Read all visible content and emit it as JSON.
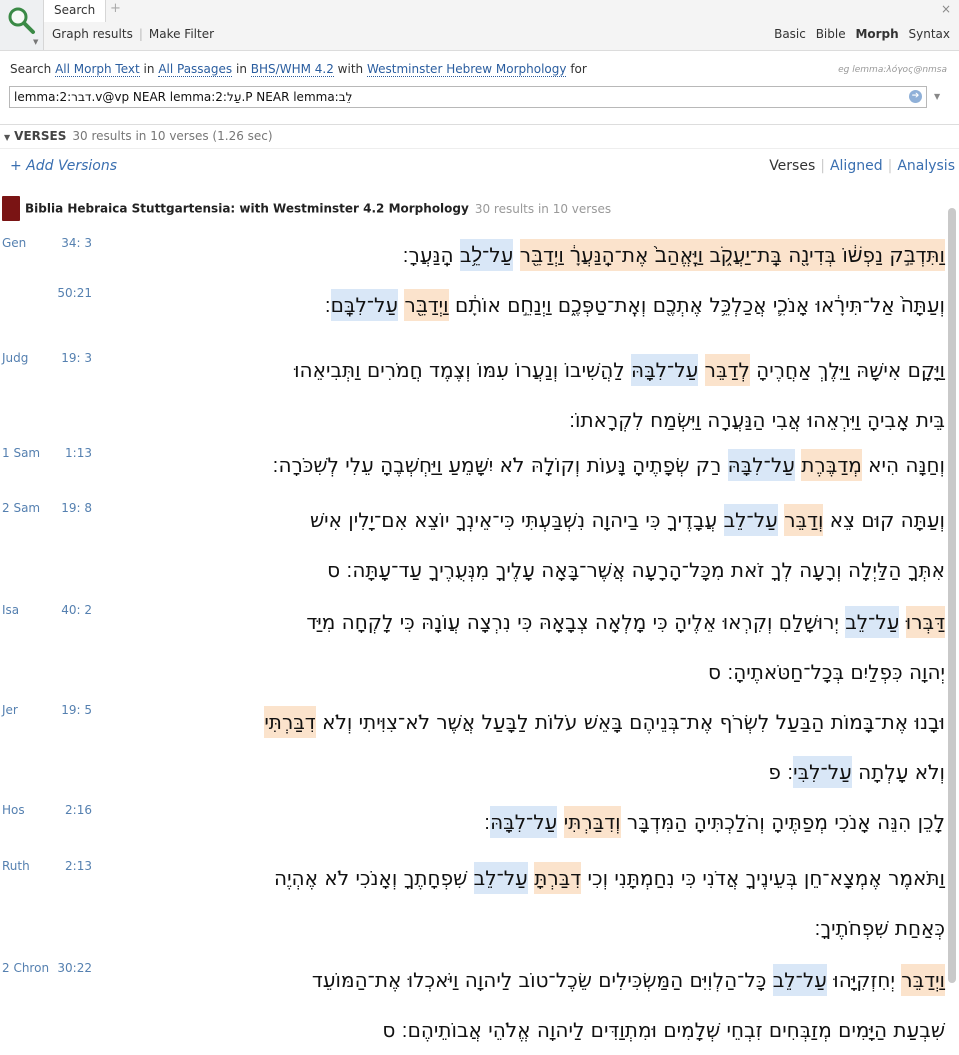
{
  "tab": {
    "label": "Search",
    "add": "+",
    "close": "×"
  },
  "toolbar": {
    "graph": "Graph results",
    "filter": "Make Filter"
  },
  "modes": [
    "Basic",
    "Bible",
    "Morph",
    "Syntax"
  ],
  "search": {
    "prefix": "Search",
    "scope": "All Morph Text",
    "in1": "in",
    "passages": "All Passages",
    "in2": "in",
    "version": "BHS/WHM 4.2",
    "with": "with",
    "morph": "Westminster Hebrew Morphology",
    "for": "for",
    "example": "eg lemma:λόγος@nmsa",
    "query": "lemma:2:דבר.v@vp NEAR lemma:2:עַל.P NEAR lemma:לֵב"
  },
  "verses_bar": {
    "label": "VERSES",
    "stats": "30 results in 10 verses (1.26 sec)"
  },
  "add_versions": "+ Add Versions",
  "views": [
    "Verses",
    "Aligned",
    "Analysis"
  ],
  "resource": {
    "title": "Biblia Hebraica Stuttgartensia: with Westminster 4.2 Morphology",
    "count": "30 results in 10 verses"
  },
  "results": [
    {
      "book": "Gen",
      "ref": "34:  3",
      "lines": [
        [
          [
            "וַתִּדְבַּ֣ק נַפְשׁ֔וֹ בְּדִינָ֖ה בַּֽת־יַעֲקֹ֑ב וַיֶּֽאֱהַב֙ אֶת־הַֽנַּעֲרָ֔ וַיְדַבֵּ֖ר",
            "hl-o"
          ],
          [
            " ",
            ""
          ],
          [
            "עַל־לֵ֥ב",
            "hl-b"
          ],
          [
            " הַֽנַּעֲרָ׃",
            ""
          ]
        ]
      ]
    },
    {
      "book": "",
      "ref": "50:21",
      "lines": [
        [
          [
            "וְעַתָּה֙ אַל־תִּירָ֔אוּ אָנֹכִ֛י אֲכַלְכֵּ֥ל אֶתְכֶ֖ם וְאֶֽת־טַפְּכֶ֑ם וַיְנַחֵ֣ם אוֹתָ֔ם",
            ""
          ],
          [
            " ",
            ""
          ],
          [
            "וַיְדַבֵּ֖ר",
            "hl-o"
          ],
          [
            " ",
            ""
          ],
          [
            "עַל־לִבָּֽם",
            "hl-b"
          ],
          [
            "׃",
            ""
          ]
        ]
      ]
    },
    {
      "book": "Judg",
      "ref": "19:  3",
      "lines": [
        [
          [
            "וַיָּקָם אִישָׁהּ וַיֵּלֶךְ אַחֲרֶיהָ ",
            ""
          ],
          [
            "לְדַבֵּר",
            "hl-o"
          ],
          [
            " ",
            ""
          ],
          [
            "עַל־לִבָּהּ",
            "hl-b"
          ],
          [
            " לַהֲשִׁיבוֹ וְנַעֲרוֹ עִמּוֹ וְצֶמֶד חֲמֹרִים וַתְּבִיאֵהוּ",
            ""
          ]
        ],
        [
          [
            "בֵּית אָבִיהָ וַיִּרְאֵהוּ אֲבִי הַנַּעֲרָה וַיִּשְׂמַח לִקְרָאתוֹ׃",
            ""
          ]
        ]
      ]
    },
    {
      "book": "1 Sam",
      "ref": "1:13",
      "lines": [
        [
          [
            "וְחַנָּה הִיא ",
            ""
          ],
          [
            "מְדַבֶּרֶת",
            "hl-o"
          ],
          [
            " ",
            ""
          ],
          [
            "עַל־לִבָּהּ",
            "hl-b"
          ],
          [
            " רַק שְׂפָתֶיהָ נָּעוֹת וְקוֹלָהּ לֹא יִשָּׁמֵעַ וַיַּחְשְׁבֶהָ עֵלִי לְשִׁכֹּרָה׃",
            ""
          ]
        ]
      ]
    },
    {
      "book": "2 Sam",
      "ref": "19:  8",
      "lines": [
        [
          [
            "וְעַתָּה קוּם צֵא ",
            ""
          ],
          [
            "וְדַבֵּר",
            "hl-o"
          ],
          [
            " ",
            ""
          ],
          [
            "עַל־לֵב",
            "hl-b"
          ],
          [
            " עֲבָדֶיךָ כִּי בַיהוָה נִשְׁבַּעְתִּי כִּי־אֵינְךָ יוֹצֵא אִם־יָלִין אִישׁ",
            ""
          ]
        ],
        [
          [
            "אִתְּךָ הַלַּיְלָה וְרָעָה לְךָ זֹאת מִכָּל־הָרָעָה אֲשֶׁר־בָּאָה עָלֶיךָ מִנְּעֻרֶיךָ עַד־עָתָּה׃ ס",
            ""
          ]
        ]
      ]
    },
    {
      "book": "Isa",
      "ref": "40:  2",
      "lines": [
        [
          [
            "דַּבְּרוּ",
            "hl-o"
          ],
          [
            " ",
            ""
          ],
          [
            "עַל־לֵב",
            "hl-b"
          ],
          [
            " יְרוּשָׁלַםִ וְקִרְאוּ אֵלֶיהָ כִּי מָלְאָה צְבָאָהּ כִּי נִרְצָה עֲוֺנָהּ כִּי לָקְחָה מִיַּד",
            ""
          ]
        ],
        [
          [
            "יְהוָה כִּפְלַיִם בְּכָל־חַטֹּאתֶיהָ׃ ס",
            ""
          ]
        ]
      ]
    },
    {
      "book": "Jer",
      "ref": "19:  5",
      "lines": [
        [
          [
            "וּבָנוּ אֶת־בָּמוֹת הַבַּעַל לִשְׂרֹף אֶת־בְּנֵיהֶם בָּאֵשׁ עֹלוֹת לַבָּעַל אֲשֶׁר לֹא־צִוִּיתִי וְלֹא ",
            ""
          ],
          [
            "דִבַּרְתִּי",
            "hl-o"
          ]
        ],
        [
          [
            "וְלֹא עָלְתָה ",
            ""
          ],
          [
            "עַל־לִבִּי",
            "hl-b"
          ],
          [
            "׃ פ",
            ""
          ]
        ]
      ]
    },
    {
      "book": "Hos",
      "ref": "2:16",
      "lines": [
        [
          [
            "לָכֵן הִנֵּה אָנֹכִי מְפַתֶּיהָ וְהֹלַכְתִּיהָ הַמִּדְבָּר ",
            ""
          ],
          [
            "וְדִבַּרְתִּי",
            "hl-o"
          ],
          [
            " ",
            ""
          ],
          [
            "עַל־לִבָּהּ",
            "hl-b"
          ],
          [
            "׃",
            ""
          ]
        ]
      ]
    },
    {
      "book": "Ruth",
      "ref": "2:13",
      "lines": [
        [
          [
            "וַתֹּאמֶר אֶמְצָא־חֵן בְּעֵינֶיךָ אֲדֹנִי כִּי נִחַמְתָּנִי וְכִי ",
            ""
          ],
          [
            "דִבַּרְתָּ",
            "hl-o"
          ],
          [
            " ",
            ""
          ],
          [
            "עַל־לֵב",
            "hl-b"
          ],
          [
            " שִׁפְחָתֶךָ וְאָנֹכִי לֹא אֶהְיֶה",
            ""
          ]
        ],
        [
          [
            "כְּאַחַת שִׁפְחֹתֶיךָ׃",
            ""
          ]
        ]
      ]
    },
    {
      "book": "2 Chron",
      "ref": "30:22",
      "lines": [
        [
          [
            "וַיְדַבֵּר",
            "hl-o"
          ],
          [
            " יְחִזְקִיָּהוּ ",
            ""
          ],
          [
            "עַל־לֵב",
            "hl-b"
          ],
          [
            " כָּל־הַלְוִיִּם הַמַּשְׂכִּילִים שֵׂכֶל־טוֹב לַיהוָה וַיֹּאכְלוּ אֶת־הַמּוֹעֵד",
            ""
          ]
        ],
        [
          [
            "שִׁבְעַת הַיָּמִים מְזַבְּחִים זִבְחֵי שְׁלָמִים וּמִתְוַדִּים לַיהוָה אֱלֹהֵי אֲבוֹתֵיהֶם׃ ס",
            ""
          ]
        ]
      ]
    }
  ]
}
